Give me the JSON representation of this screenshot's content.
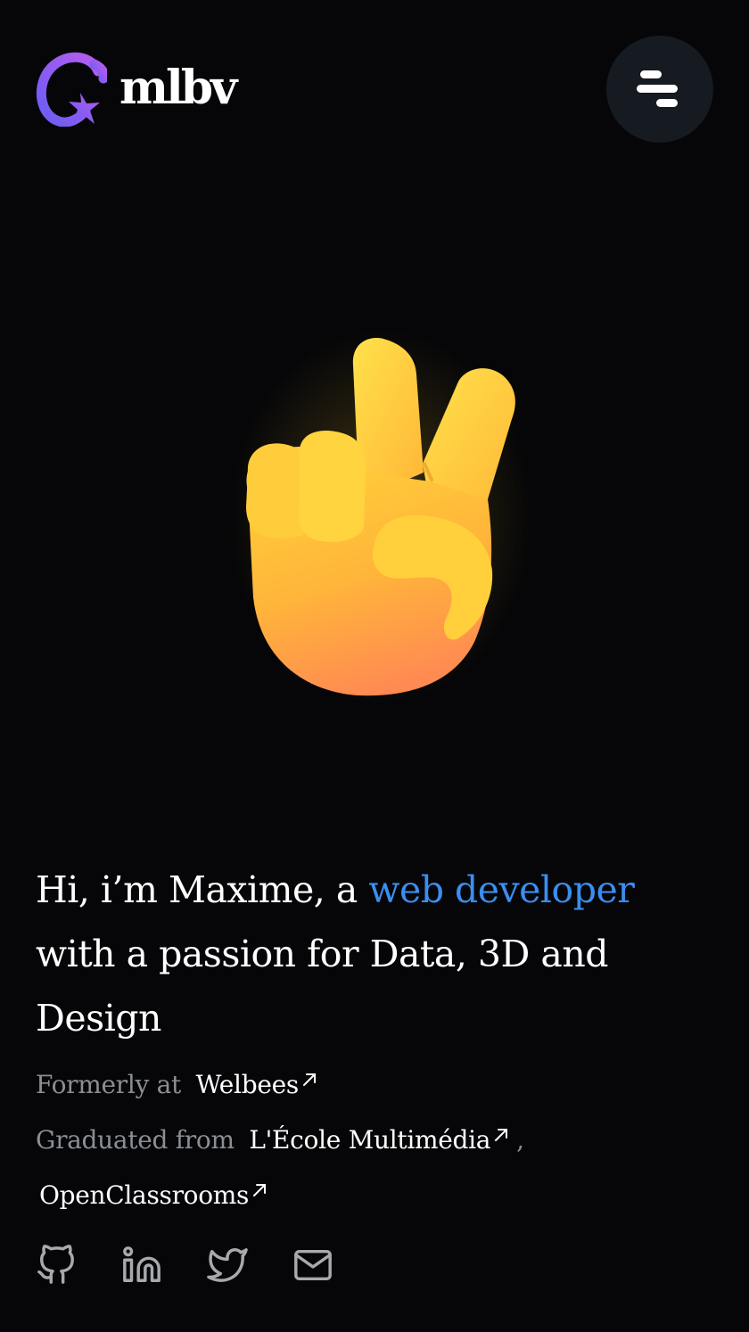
{
  "header": {
    "logo_text": "mlbv",
    "logo_icon": "star-g-logo-icon",
    "menu_icon": "menu-icon",
    "accent_gradient": [
      "#5b6cf7",
      "#a35cf0"
    ]
  },
  "hero": {
    "emoji_icon": "victory-hand-icon"
  },
  "intro": {
    "part1": "Hi, i’m Maxime, a ",
    "accent": "web developer",
    "part2": " with a passion for Data, 3D and Design",
    "accent_color": "#3b8ef0"
  },
  "formerly": {
    "label": "Formerly at",
    "link": "Welbees"
  },
  "graduated": {
    "label": "Graduated from",
    "link1": "L'École Multimédia",
    "separator": ",",
    "link2": "OpenClassrooms"
  },
  "socials": [
    {
      "icon": "github-icon"
    },
    {
      "icon": "linkedin-icon"
    },
    {
      "icon": "twitter-icon"
    },
    {
      "icon": "mail-icon"
    }
  ],
  "colors": {
    "background": "#060608",
    "menu_button_bg": "#161a21",
    "muted_text": "#8b8e94",
    "icon_gray": "#a7a9ad"
  }
}
